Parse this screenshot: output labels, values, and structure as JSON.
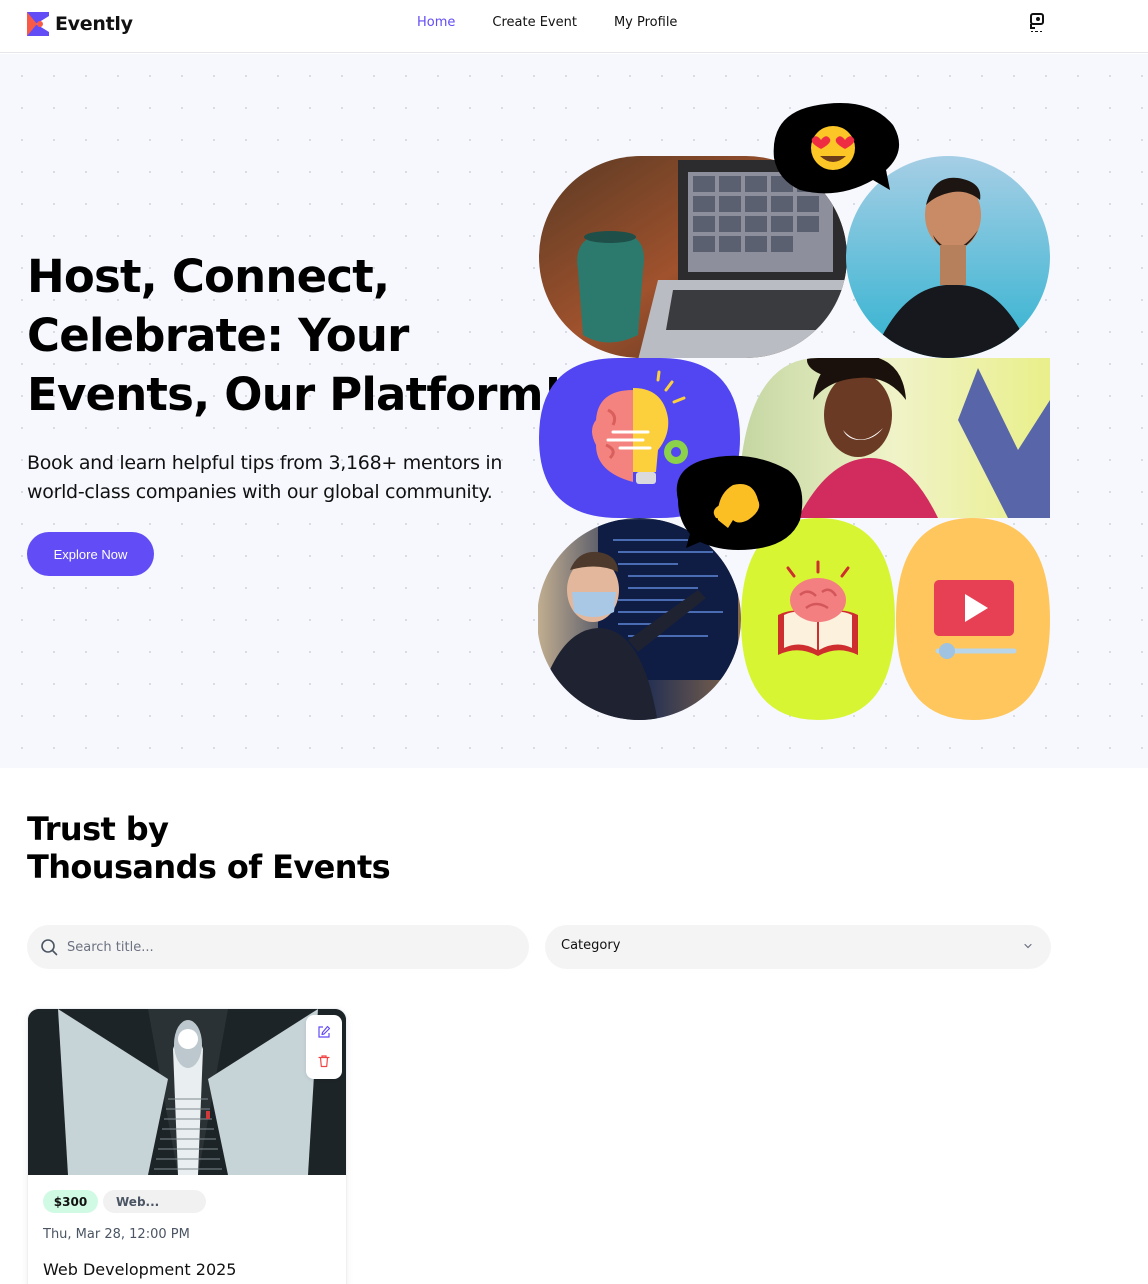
{
  "app": {
    "name": "Evently"
  },
  "nav": {
    "items": [
      {
        "label": "Home",
        "active": true
      },
      {
        "label": "Create Event",
        "active": false
      },
      {
        "label": "My Profile",
        "active": false
      }
    ]
  },
  "hero": {
    "title_lines": [
      "Host, Connect,",
      "Celebrate: Your",
      "Events, Our Platform!"
    ],
    "subtitle_lines": [
      "Book and learn helpful tips from 3,168+ mentors in",
      "world-class companies with our global community."
    ],
    "cta_label": "Explore Now"
  },
  "section": {
    "title_lines": [
      "Trust by",
      "Thousands of Events"
    ]
  },
  "search": {
    "placeholder": "Search title..."
  },
  "category": {
    "label": "Category"
  },
  "events": [
    {
      "price": "$300",
      "category": "Web...",
      "date": "Thu, Mar 28, 12:00 PM",
      "title": "Web Development 2025"
    }
  ],
  "colors": {
    "brand": "#624cf5",
    "hero_bg": "#f6f8fd",
    "price_badge_bg": "#d1fae5",
    "delete_red": "#ef4444"
  }
}
